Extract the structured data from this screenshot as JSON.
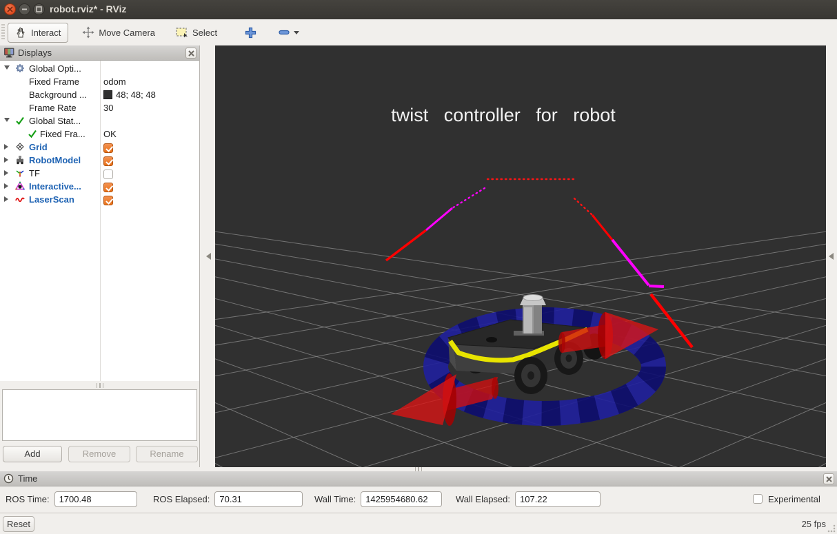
{
  "window": {
    "title": "robot.rviz* - RViz",
    "buttons": [
      {
        "name": "close-window-button",
        "icon": "close-icon"
      },
      {
        "name": "minimize-window-button",
        "icon": "minimize-icon"
      },
      {
        "name": "maximize-window-button",
        "icon": "maximize-icon"
      }
    ]
  },
  "toolbar": {
    "tools": [
      {
        "label": "Interact",
        "icon": "hand-icon",
        "active": true
      },
      {
        "label": "Move Camera",
        "icon": "move-camera-icon",
        "active": false
      },
      {
        "label": "Select",
        "icon": "select-icon",
        "active": false
      }
    ],
    "zoom_in_icon": "plus-icon",
    "zoom_out_icon": "minus-icon"
  },
  "displays_panel": {
    "title": "Displays",
    "rows": [
      {
        "label": "Global Opti...",
        "icon": "gear-icon",
        "expander": "open",
        "indent": 0
      },
      {
        "label": "Fixed Frame",
        "value": "odom",
        "indent": 1
      },
      {
        "label": "Background ...",
        "value": "48; 48; 48",
        "swatch": "#303030",
        "indent": 1
      },
      {
        "label": "Frame Rate",
        "value": "30",
        "indent": 1
      },
      {
        "label": "Global Stat...",
        "icon": "check-icon",
        "expander": "open",
        "indent": 0
      },
      {
        "label": "Fixed Fra...",
        "value": "OK",
        "icon": "check-icon",
        "indent": 1
      },
      {
        "label": "Grid",
        "icon": "grid-icon",
        "expander": "closed",
        "blue": true,
        "checkbox": true,
        "checked": true,
        "indent": 0
      },
      {
        "label": "RobotModel",
        "icon": "robot-icon",
        "expander": "closed",
        "blue": true,
        "checkbox": true,
        "checked": true,
        "indent": 0
      },
      {
        "label": "TF",
        "icon": "tf-icon",
        "expander": "closed",
        "blue": false,
        "checkbox": true,
        "checked": false,
        "indent": 0
      },
      {
        "label": "Interactive...",
        "icon": "marker-icon",
        "expander": "closed",
        "blue": true,
        "checkbox": true,
        "checked": true,
        "indent": 0
      },
      {
        "label": "LaserScan",
        "icon": "laser-icon",
        "expander": "closed",
        "blue": true,
        "checkbox": true,
        "checked": true,
        "indent": 0
      }
    ],
    "buttons": {
      "add": "Add",
      "remove": "Remove",
      "rename": "Rename"
    }
  },
  "viewport": {
    "overlay_text": "twist controller for robot"
  },
  "scene": {
    "grid_color": "#8d8d8d",
    "grid_lines": [
      {
        "p": [
          -2100,
          700,
          1720,
          150
        ]
      },
      {
        "p": [
          -1600,
          700,
          1720,
          150
        ]
      },
      {
        "p": [
          -1150,
          700,
          1720,
          150
        ]
      },
      {
        "p": [
          -750,
          700,
          1720,
          150
        ]
      },
      {
        "p": [
          -390,
          700,
          1720,
          150
        ]
      },
      {
        "p": [
          -70,
          700,
          1720,
          150
        ]
      },
      {
        "p": [
          215,
          700,
          1720,
          150
        ]
      },
      {
        "p": [
          475,
          700,
          1720,
          150
        ]
      },
      {
        "p": [
          715,
          700,
          1720,
          150
        ]
      },
      {
        "p": [
          935,
          700,
          1720,
          150
        ]
      },
      {
        "p": [
          2986,
          700,
          -834,
          150
        ]
      },
      {
        "p": [
          2486,
          700,
          -834,
          150
        ]
      },
      {
        "p": [
          2036,
          700,
          -834,
          150
        ]
      },
      {
        "p": [
          1636,
          700,
          -834,
          150
        ]
      },
      {
        "p": [
          1276,
          700,
          -834,
          150
        ]
      },
      {
        "p": [
          956,
          700,
          -834,
          150
        ]
      },
      {
        "p": [
          671,
          700,
          -834,
          150
        ]
      },
      {
        "p": [
          411,
          700,
          -834,
          150
        ]
      },
      {
        "p": [
          171,
          700,
          -834,
          150
        ]
      },
      {
        "p": [
          -49,
          700,
          -834,
          150
        ]
      }
    ],
    "laser_segments": [
      {
        "p": [
          395,
          194,
          521,
          194
        ],
        "c": "#ff1414",
        "w": 2.4,
        "d": "1.5 5"
      },
      {
        "p": [
          391,
          207,
          344,
          236
        ],
        "c": "#ff00ff",
        "w": 2.4,
        "d": "1.5 5"
      },
      {
        "p": [
          344,
          236,
          306,
          268
        ],
        "c": "#ff00ff",
        "w": 3
      },
      {
        "p": [
          306,
          268,
          248,
          312
        ],
        "c": "#ff0000",
        "w": 3.4
      },
      {
        "p": [
          521,
          222,
          547,
          246
        ],
        "c": "#ff1414",
        "w": 2.4,
        "d": "1.5 5"
      },
      {
        "p": [
          547,
          246,
          576,
          282
        ],
        "c": "#ff0000",
        "w": 3
      },
      {
        "p": [
          576,
          282,
          629,
          348
        ],
        "c": "#ff00ff",
        "w": 4
      },
      {
        "p": [
          629,
          349,
          651,
          350
        ],
        "c": "#ff00ff",
        "w": 4
      },
      {
        "p": [
          632,
          361,
          692,
          438
        ],
        "c": "#ff0000",
        "w": 4.4
      }
    ],
    "marker_ring_color": "#20209d",
    "marker_arrow_color": "#d00000",
    "laser_red": "#ff0000",
    "laser_magenta": "#ff00ff",
    "background": "#303030"
  },
  "time_panel": {
    "title": "Time",
    "fields": [
      {
        "label": "ROS Time:",
        "value": "1700.48"
      },
      {
        "label": "ROS Elapsed:",
        "value": "70.31"
      },
      {
        "label": "Wall Time:",
        "value": "1425954680.62"
      },
      {
        "label": "Wall Elapsed:",
        "value": "107.22"
      }
    ],
    "experimental_label": "Experimental"
  },
  "status_bar": {
    "reset_label": "Reset",
    "fps": "25 fps"
  }
}
